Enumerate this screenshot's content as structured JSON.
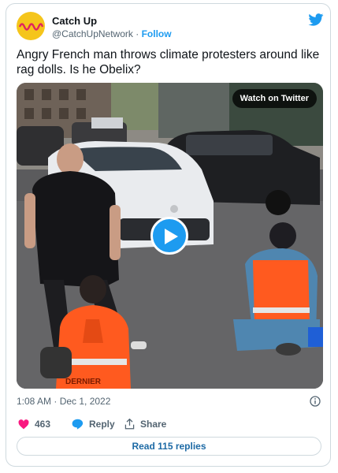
{
  "account": {
    "name": "Catch Up",
    "handle": "@CatchUpNetwork",
    "separator": "·",
    "follow_label": "Follow"
  },
  "tweet": {
    "text": "Angry French man throws climate protesters around like rag dolls. Is he Obelix?",
    "timestamp": "1:08 AM · Dec 1, 2022"
  },
  "media": {
    "watch_label": "Watch on Twitter",
    "vest_text": "DERNIER"
  },
  "actions": {
    "likes": "463",
    "reply_label": "Reply",
    "share_label": "Share"
  },
  "read_replies_label": "Read 115 replies",
  "colors": {
    "accent": "#1d9bf0",
    "like": "#f91880",
    "avatar_bg": "#f5c51b",
    "avatar_wave": "#e0245e"
  },
  "icons": [
    "twitter-bird-icon",
    "play-icon",
    "info-icon",
    "heart-icon",
    "reply-bubble-icon",
    "share-icon"
  ]
}
